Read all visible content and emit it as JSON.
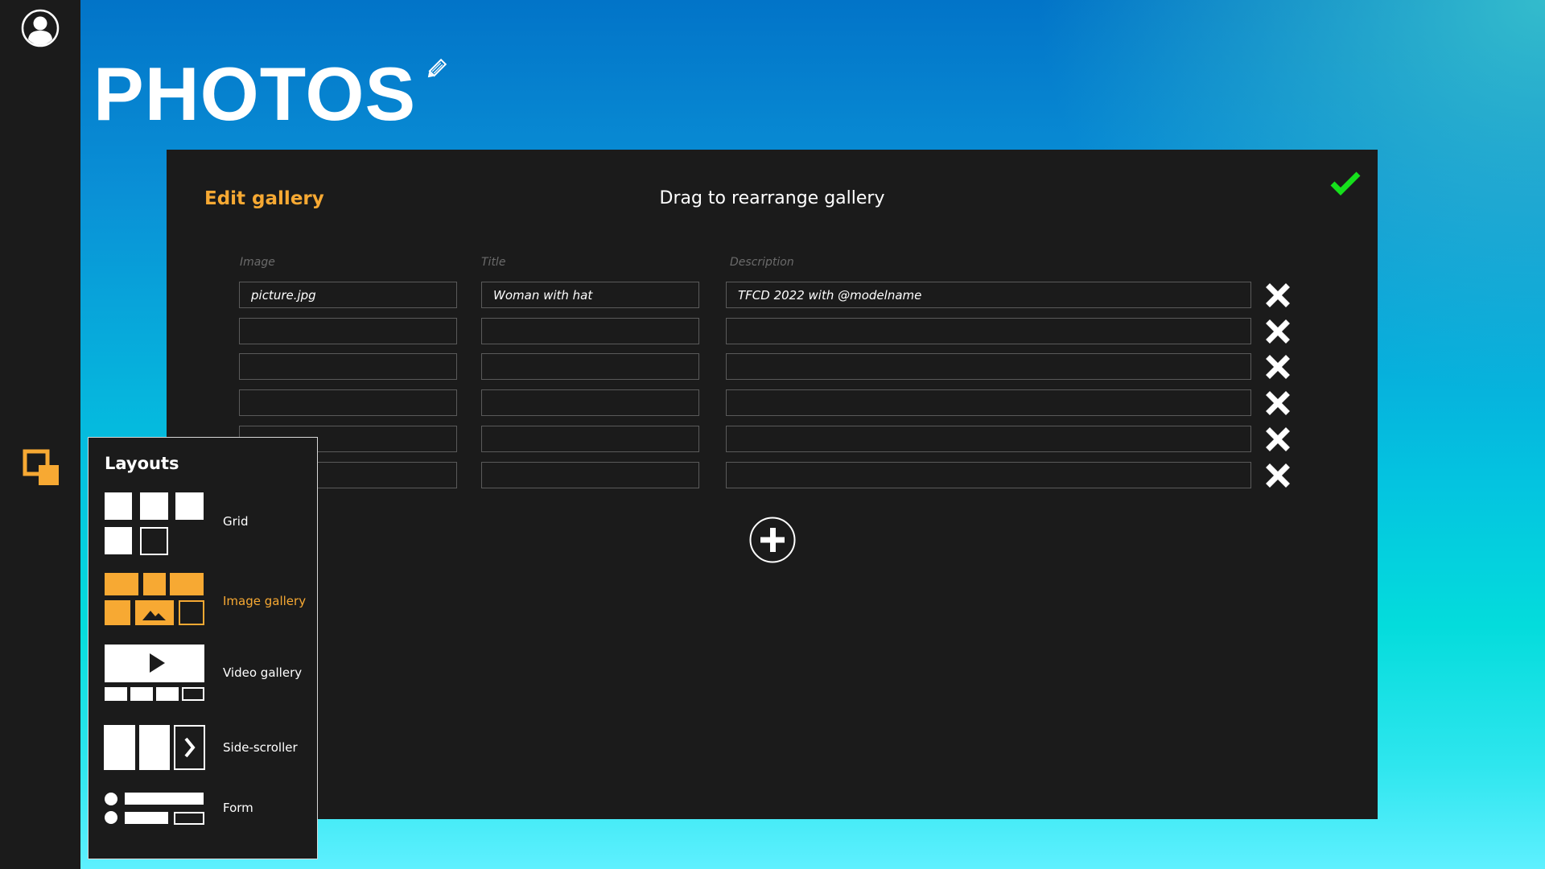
{
  "app": {
    "title": "PHOTOS",
    "icons": {
      "user": "user-avatar-icon",
      "edit_title": "pencil-icon",
      "layouts": "layout-overlap-icon"
    }
  },
  "editor": {
    "title": "Edit gallery",
    "subtitle": "Drag to rearrange gallery",
    "confirm_icon": "checkmark-icon",
    "columns": [
      "Image",
      "Title",
      "Description"
    ],
    "rows": [
      {
        "image": "picture.jpg",
        "title": "Woman with hat",
        "description": "TFCD 2022 with @modelname"
      },
      {
        "image": "",
        "title": "",
        "description": ""
      },
      {
        "image": "",
        "title": "",
        "description": ""
      },
      {
        "image": "",
        "title": "",
        "description": ""
      },
      {
        "image": "",
        "title": "",
        "description": ""
      },
      {
        "image": "",
        "title": "",
        "description": ""
      }
    ],
    "remove_icon": "close-x-icon",
    "add_icon": "plus-circle-icon"
  },
  "layouts": {
    "title": "Layouts",
    "items": [
      {
        "label": "Grid",
        "icon": "grid-layout-icon",
        "selected": false
      },
      {
        "label": "Image gallery",
        "icon": "image-gallery-layout-icon",
        "selected": true
      },
      {
        "label": "Video gallery",
        "icon": "video-gallery-layout-icon",
        "selected": false
      },
      {
        "label": "Side-scroller",
        "icon": "side-scroller-layout-icon",
        "selected": false
      },
      {
        "label": "Form",
        "icon": "form-layout-icon",
        "selected": false
      }
    ]
  },
  "colors": {
    "accent": "#f7a933",
    "confirm": "#16e01c",
    "panel": "#1b1b1b",
    "text": "#ffffff"
  }
}
